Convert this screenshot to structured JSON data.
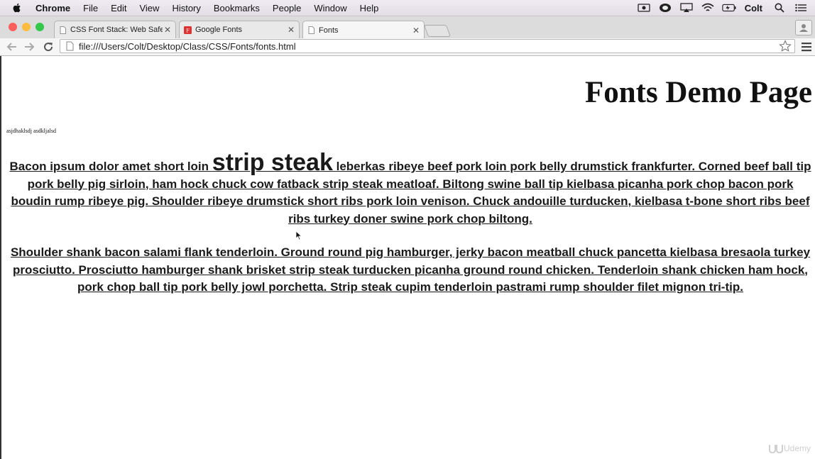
{
  "menubar": {
    "app": "Chrome",
    "items": [
      "File",
      "Edit",
      "View",
      "History",
      "Bookmarks",
      "People",
      "Window",
      "Help"
    ],
    "user": "Colt"
  },
  "tabs": [
    {
      "title": "CSS Font Stack: Web Safe",
      "icon": "document-icon"
    },
    {
      "title": "Google Fonts",
      "icon": "google-fonts-icon"
    },
    {
      "title": "Fonts",
      "icon": "document-icon"
    }
  ],
  "address": {
    "url": "file:///Users/Colt/Desktop/Class/CSS/Fonts/fonts.html"
  },
  "page": {
    "heading": "Fonts Demo Page",
    "small_text": "asjdhaklsdj asdkljalsd",
    "p1_start": "Bacon ipsum dolor amet short loin",
    "p1_big": "strip steak",
    "p1_rest": "leberkas ribeye beef pork loin pork belly drumstick frankfurter. Corned beef ball tip pork belly pig sirloin, ham hock chuck cow fatback strip steak meatloaf. Biltong swine ball tip kielbasa picanha pork chop bacon pork boudin rump ribeye pig. Shoulder ribeye drumstick short ribs pork loin venison. Chuck andouille turducken, kielbasa t-bone short ribs beef ribs turkey doner swine pork chop biltong.",
    "p2": "Shoulder shank bacon salami flank tenderloin. Ground round pig hamburger, jerky bacon meatball chuck pancetta kielbasa bresaola turkey prosciutto. Prosciutto hamburger shank brisket strip steak turducken picanha ground round chicken. Tenderloin shank chicken ham hock, pork chop ball tip pork belly jowl porchetta. Strip steak cupim tenderloin pastrami rump shoulder filet mignon tri-tip."
  },
  "watermark": "Udemy",
  "colors": {
    "close": "#fc605c",
    "minimize": "#fdbc40",
    "zoom": "#34c84a"
  }
}
